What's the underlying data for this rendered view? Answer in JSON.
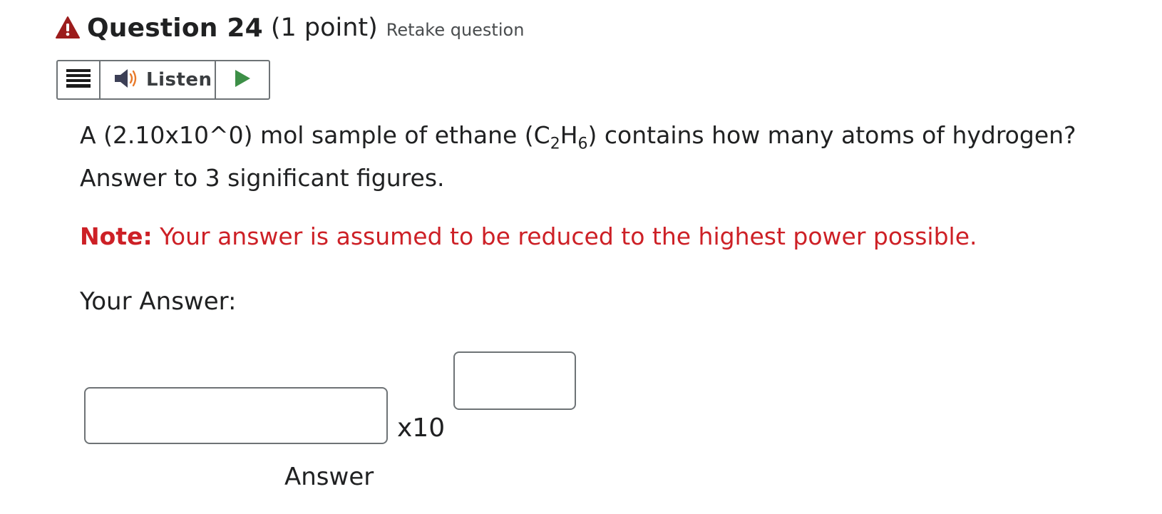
{
  "header": {
    "icon": "warning-icon",
    "title": "Question 24",
    "points": "(1 point)",
    "retake": "Retake question"
  },
  "toolbar": {
    "menu_icon": "menu-icon",
    "listen_icon": "speaker-icon",
    "listen_label": "Listen",
    "play_icon": "play-icon"
  },
  "question": {
    "text_part1": "A (2.10x10^0) mol sample of ethane (C",
    "sub_c": "2",
    "text_part2": "H",
    "sub_h": "6",
    "text_part3": ") contains how many atoms of hydrogen? Answer to 3 significant figures."
  },
  "note": {
    "label": "Note:",
    "text": " Your answer is assumed to be reduced to the highest power possible."
  },
  "answer": {
    "heading": "Your Answer:",
    "value": "",
    "multiplier": "x10",
    "exponent": "",
    "caption": "Answer"
  },
  "colors": {
    "warning": "#9c1c1c",
    "note_red": "#cd2026",
    "play_green": "#3d8f47",
    "speaker_orange": "#e87a2b",
    "border_gray": "#6e7376"
  }
}
